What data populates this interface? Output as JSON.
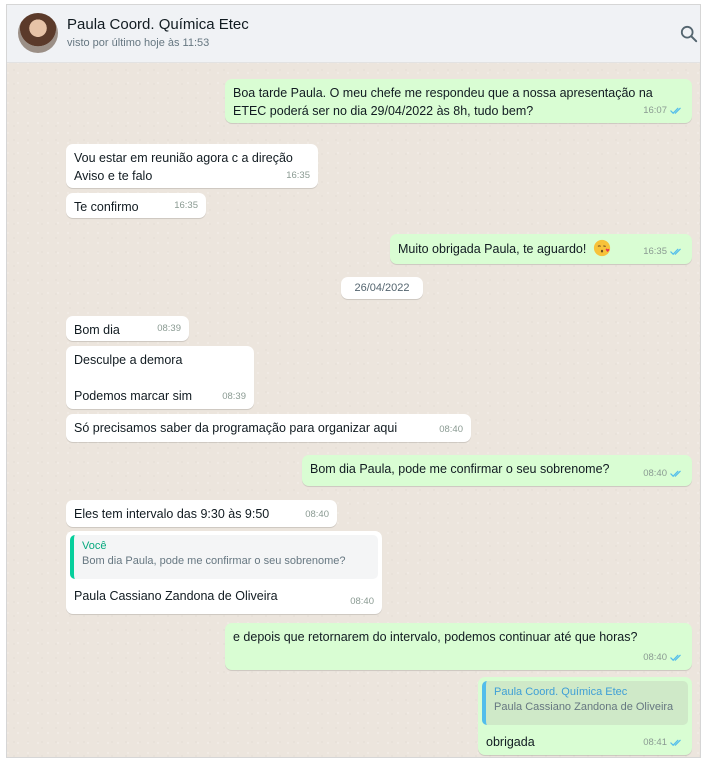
{
  "header": {
    "contact_name": "Paula Coord. Química Etec",
    "status": "visto por último hoje às 11:53"
  },
  "icons": {
    "search": "search-icon",
    "read_receipt": "double-check-icon",
    "emoji": "kissing-face-emoji"
  },
  "colors": {
    "incoming_bubble": "#ffffff",
    "outgoing_bubble": "#d9fdd3",
    "read_check": "#53bdeb",
    "quote_bar_contact": "#06cf9c",
    "quote_bar_self": "#53bdeb"
  },
  "messages": [
    {
      "dir": "out",
      "text": "Boa tarde Paula. O meu chefe me respondeu que a nossa apresentação na ETEC poderá ser no dia 29/04/2022 às 8h, tudo bem?",
      "time": "16:07"
    },
    {
      "dir": "in",
      "text": "Vou estar em reunião agora c a direção\nAviso e te falo",
      "time": "16:35"
    },
    {
      "dir": "in",
      "text": "Te confirmo",
      "time": "16:35"
    },
    {
      "dir": "out",
      "text": "Muito obrigada Paula, te aguardo!",
      "time": "16:35"
    },
    {
      "dir": "in",
      "text": "Bom dia",
      "time": "08:39"
    },
    {
      "dir": "in",
      "text": "Desculpe a demora\n\nPodemos marcar sim",
      "time": "08:39"
    },
    {
      "dir": "in",
      "text": "Só precisamos saber da programação para organizar aqui",
      "time": "08:40"
    },
    {
      "dir": "out",
      "text": "Bom dia Paula, pode me confirmar o seu sobrenome?",
      "time": "08:40"
    },
    {
      "dir": "in",
      "text": "Eles tem intervalo das 9:30 às 9:50",
      "time": "08:40"
    },
    {
      "dir": "in",
      "text": "Paula Cassiano Zandona de Oliveira",
      "time": "08:40",
      "quote_author": "Você",
      "quote_text": "Bom dia Paula, pode me confirmar o seu sobrenome?"
    },
    {
      "dir": "out",
      "text": "e depois que retornarem do intervalo, podemos continuar até que horas?",
      "time": "08:40"
    },
    {
      "dir": "out",
      "text": "obrigada",
      "time": "08:41",
      "quote_author": "Paula Coord. Química Etec",
      "quote_text": "Paula Cassiano Zandona de Oliveira"
    }
  ],
  "date_divider": "26/04/2022"
}
